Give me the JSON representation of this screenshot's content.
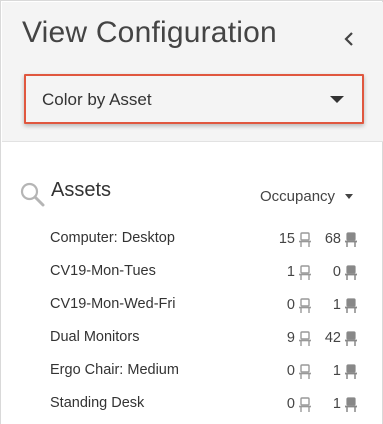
{
  "panel": {
    "title": "View Configuration",
    "collapse_icon": "chevron-left-icon"
  },
  "color_select": {
    "value": "Color by Asset",
    "accent_color": "#e0573f"
  },
  "assets": {
    "title": "Assets",
    "search_icon": "search-icon",
    "sort_label": "Occupancy",
    "rows": [
      {
        "name": "Computer: Desktop",
        "count_a": "15",
        "count_b": "68"
      },
      {
        "name": "CV19-Mon-Tues",
        "count_a": "1",
        "count_b": "0"
      },
      {
        "name": "CV19-Mon-Wed-Fri",
        "count_a": "0",
        "count_b": "1"
      },
      {
        "name": "Dual Monitors",
        "count_a": "9",
        "count_b": "42"
      },
      {
        "name": "Ergo Chair: Medium",
        "count_a": "0",
        "count_b": "1"
      },
      {
        "name": "Standing Desk",
        "count_a": "0",
        "count_b": "1"
      }
    ]
  }
}
